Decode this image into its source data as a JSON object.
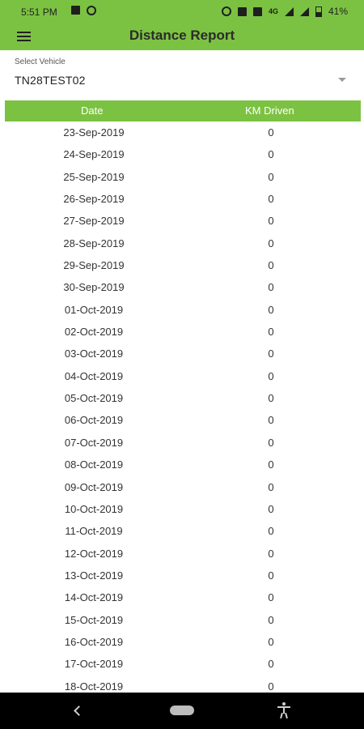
{
  "status_bar": {
    "time": "5:51 PM",
    "battery_percent": "41%",
    "network_label": "4G",
    "icons_left": [
      "image-icon",
      "instagram-icon"
    ],
    "icons_right": [
      "eye-comfort-icon",
      "volte-icon",
      "volte-icon",
      "4g-icon",
      "signal-icon",
      "signal-icon",
      "battery-icon"
    ]
  },
  "app_bar": {
    "title": "Distance Report",
    "menu_icon": "hamburger-menu-icon",
    "color": "#7cc242"
  },
  "vehicle_select": {
    "label": "Select Vehicle",
    "value": "TN28TEST02",
    "icon": "chevron-down-icon"
  },
  "table": {
    "headers": [
      "Date",
      "KM Driven"
    ],
    "header_color": "#7cc242",
    "rows": [
      {
        "date": "23-Sep-2019",
        "km": "0"
      },
      {
        "date": "24-Sep-2019",
        "km": "0"
      },
      {
        "date": "25-Sep-2019",
        "km": "0"
      },
      {
        "date": "26-Sep-2019",
        "km": "0"
      },
      {
        "date": "27-Sep-2019",
        "km": "0"
      },
      {
        "date": "28-Sep-2019",
        "km": "0"
      },
      {
        "date": "29-Sep-2019",
        "km": "0"
      },
      {
        "date": "30-Sep-2019",
        "km": "0"
      },
      {
        "date": "01-Oct-2019",
        "km": "0"
      },
      {
        "date": "02-Oct-2019",
        "km": "0"
      },
      {
        "date": "03-Oct-2019",
        "km": "0"
      },
      {
        "date": "04-Oct-2019",
        "km": "0"
      },
      {
        "date": "05-Oct-2019",
        "km": "0"
      },
      {
        "date": "06-Oct-2019",
        "km": "0"
      },
      {
        "date": "07-Oct-2019",
        "km": "0"
      },
      {
        "date": "08-Oct-2019",
        "km": "0"
      },
      {
        "date": "09-Oct-2019",
        "km": "0"
      },
      {
        "date": "10-Oct-2019",
        "km": "0"
      },
      {
        "date": "11-Oct-2019",
        "km": "0"
      },
      {
        "date": "12-Oct-2019",
        "km": "0"
      },
      {
        "date": "13-Oct-2019",
        "km": "0"
      },
      {
        "date": "14-Oct-2019",
        "km": "0"
      },
      {
        "date": "15-Oct-2019",
        "km": "0"
      },
      {
        "date": "16-Oct-2019",
        "km": "0"
      },
      {
        "date": "17-Oct-2019",
        "km": "0"
      },
      {
        "date": "18-Oct-2019",
        "km": "0"
      }
    ]
  },
  "nav_bar": {
    "icons": [
      "back-icon",
      "home-pill-icon",
      "accessibility-icon"
    ]
  }
}
